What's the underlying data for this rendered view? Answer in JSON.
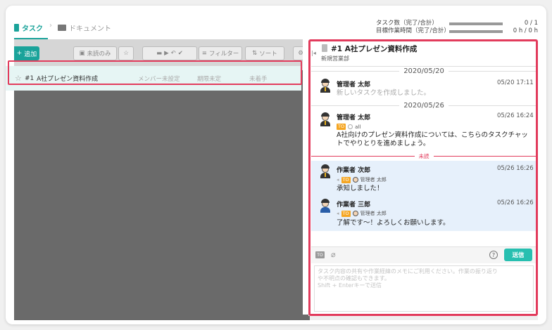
{
  "tabs": [
    {
      "label": "タスク"
    },
    {
      "label": "ドキュメント"
    }
  ],
  "stats": {
    "task_count_label": "タスク数（完了/合計）",
    "task_count_value": "0 / 1",
    "hours_label": "目標作業時間（完了/合計）",
    "hours_value": "0 h / 0 h"
  },
  "toolbar": {
    "add_label": "追加",
    "unread_only_label": "未読のみ",
    "filter_label": "フィルター",
    "sort_label": "ソート"
  },
  "task_row": {
    "number": "#1",
    "name": "A社プレゼン資料作成",
    "member": "メンバー未設定",
    "deadline": "期限未定",
    "status": "未着手"
  },
  "panel": {
    "title": "#1 A社プレゼン資料作成",
    "subtitle": "新規営業部"
  },
  "dates": [
    "2020/05/20",
    "2020/05/26"
  ],
  "unread_label": "未読",
  "messages": [
    {
      "name": "管理者 太郎",
      "time": "05/20 17:11",
      "text": "新しいタスクを作成しました。"
    },
    {
      "name": "管理者 太郎",
      "time": "05/26 16:24",
      "to": "all",
      "text_line1": "A社向けのプレゼン資料作成については、こちらのタスクチャッ",
      "text_line2": "トでやりとりを進めましょう。"
    },
    {
      "name": "作業者 次郎",
      "time": "05/26 16:26",
      "to": "管理者 太郎",
      "text": "承知しました！"
    },
    {
      "name": "作業者 三郎",
      "time": "05/26 16:26",
      "to": "管理者 太郎",
      "text": "了解です〜！よろしくお願いします。"
    }
  ],
  "to_badge": "TO",
  "composer": {
    "send_label": "送信",
    "help_label": "?",
    "placeholder_line1": "タスク内容の共有や作業経緯のメモにご利用ください。作業の振り返り",
    "placeholder_line2": "や不明点の確認もできます。",
    "placeholder_line3": "Shift + Enterキーで送信"
  },
  "colors": {
    "accent": "#1aa39a",
    "highlight": "#e23b5c",
    "to_badge": "#f5a623",
    "send": "#27bfb0"
  }
}
